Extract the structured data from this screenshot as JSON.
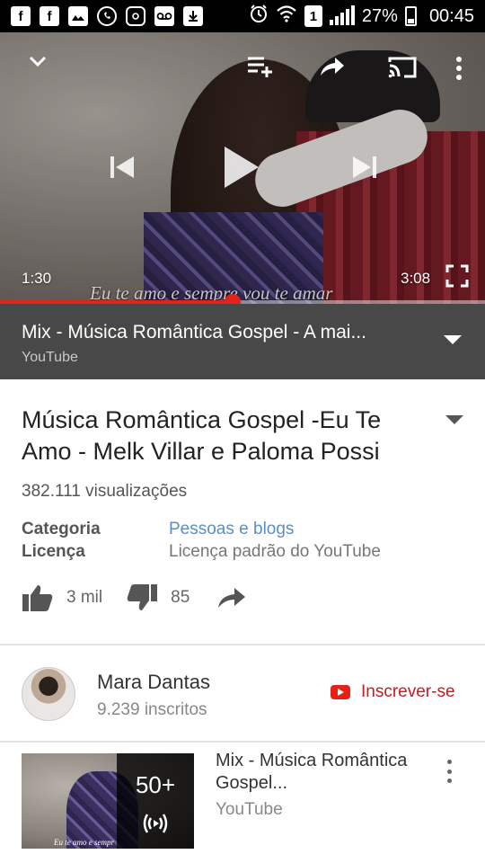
{
  "status_bar": {
    "battery": "27%",
    "time": "00:45",
    "sim_badge": "1",
    "icons": [
      "facebook-icon",
      "facebook-icon",
      "gallery-icon",
      "whatsapp-icon",
      "instagram-icon",
      "voicemail-icon",
      "download-icon",
      "alarm-icon",
      "wifi-icon",
      "sim-icon",
      "signal-icon",
      "battery-icon"
    ]
  },
  "player": {
    "current_time": "1:30",
    "duration": "3:08",
    "progress": 0.48,
    "subtitle_overlay": "Eu te amo e sempre vou te amar",
    "controls": [
      "collapse",
      "add-to-queue",
      "share",
      "cast",
      "more",
      "previous",
      "play",
      "next",
      "fullscreen"
    ]
  },
  "mix_bar": {
    "title": "Mix - Música Romântica Gospel - A mai...",
    "source": "YouTube"
  },
  "video": {
    "title": "Música Romântica Gospel -Eu Te Amo - Melk Villar e Paloma Possi",
    "views": "382.111 visualizações",
    "category_label": "Categoria",
    "category_value": "Pessoas e blogs",
    "license_label": "Licença",
    "license_value": "Licença padrão do YouTube",
    "likes": "3 mil",
    "dislikes": "85"
  },
  "channel": {
    "name": "Mara Dantas",
    "subscribers": "9.239 inscritos",
    "subscribe_label": "Inscrever-se"
  },
  "playlist_item": {
    "title": "Mix - Música Romântica Gospel...",
    "source": "YouTube",
    "count": "50+",
    "thumb_caption": "Eu te amo e sempr"
  },
  "colors": {
    "accent_red": "#e62117",
    "subscribe_red": "#cc181e",
    "link_blue": "#5b8ec4",
    "mix_bar_bg": "#484848"
  }
}
